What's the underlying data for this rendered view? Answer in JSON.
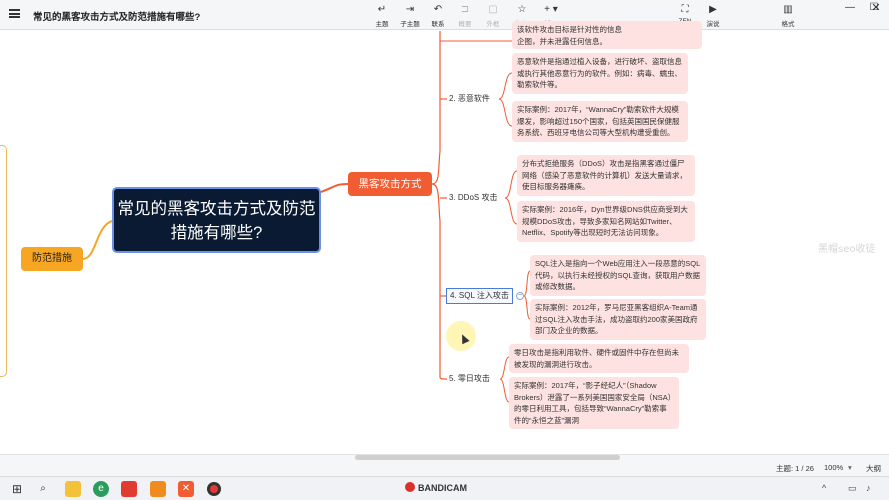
{
  "window": {
    "title": "常见的黑客攻击方式及防范措施有哪些?",
    "controls": [
      "minimize",
      "maximize",
      "close"
    ]
  },
  "toolbar": {
    "tools": [
      {
        "label": "主题",
        "icon": "enter-arrow-icon",
        "enabled": true
      },
      {
        "label": "子主题",
        "icon": "tab-arrow-icon",
        "enabled": true
      },
      {
        "label": "联系",
        "icon": "undo-curve-icon",
        "enabled": true
      },
      {
        "label": "概要",
        "icon": "bracket-icon",
        "enabled": false
      },
      {
        "label": "外框",
        "icon": "frame-icon",
        "enabled": false
      },
      {
        "label": "标记",
        "icon": "star-icon",
        "enabled": true
      },
      {
        "label": "插入",
        "icon": "plus-icon",
        "enabled": true
      }
    ],
    "zen_label": "ZEN",
    "present_label": "演说",
    "format_label": "格式"
  },
  "mindmap": {
    "root": "常见的黑客攻击方式及防范措施有哪些?",
    "main_topic": "黑客攻击方式",
    "left_topic": "防范措施",
    "subtopics": [
      {
        "label": "2. 恶意软件",
        "items": [
          "恶意软件是指通过植入设备，进行破坏、盗取信息或执行其他恶意行为的软件。例如：病毒、蠕虫、勒索软件等。",
          "实际案例：2017年，“WannaCry”勒索软件大规模爆发，影响超过150个国家，包括英国国民保健服务系统、西班牙电信公司等大型机构遭受重创。"
        ]
      },
      {
        "label": "3. DDoS 攻击",
        "items": [
          "分布式拒绝服务（DDoS）攻击是指黑客通过僵尸网络（感染了恶意软件的计算机）发送大量请求，使目标服务器瘫痪。",
          "实际案例：2016年，Dyn世界级DNS供应商受到大规模DDoS攻击，导致多家知名网站如Twitter、Netflix、Spotify等出现短时无法访问现象。"
        ]
      },
      {
        "label": "4. SQL 注入攻击",
        "items": [
          "SQL注入是指向一个Web应用注入一段恶意的SQL代码，以执行未经授权的SQL查询，获取用户数据或修改数据。",
          "实际案例：2012年，罗马尼亚黑客组织A-Team通过SQL注入攻击手法，成功盗取约200家美国政府部门及企业的数据。"
        ]
      },
      {
        "label": "5. 零日攻击",
        "items": [
          "零日攻击是指利用软件、硬件或固件中存在但尚未被发现的漏洞进行攻击。",
          "实际案例：2017年，“影子经纪人”（Shadow Brokers）泄露了一系列美国国家安全局（NSA）的零日利用工具，包括导致“WannaCry”勒索事件的“永恒之蓝”漏洞"
        ]
      }
    ],
    "partial_top_text": "企图，并未泄露任何信息。",
    "partial_top_line": "该软件攻击目标是针对性的信息"
  },
  "watermarks": {
    "phone": "16485673000",
    "brand": "黑帽seo收徒"
  },
  "statusbar": {
    "topic_count": "主题: 1 / 26",
    "zoom": "100%",
    "font_size_label": "大纲"
  },
  "taskbar": {
    "app_name": "BANDICAM",
    "icons": [
      "windows-logo-icon",
      "search-icon",
      "file-explorer-icon",
      "edge-browser-icon",
      "red-app-icon",
      "orange-app-icon",
      "orange-x-app-icon",
      "record-icon"
    ]
  }
}
